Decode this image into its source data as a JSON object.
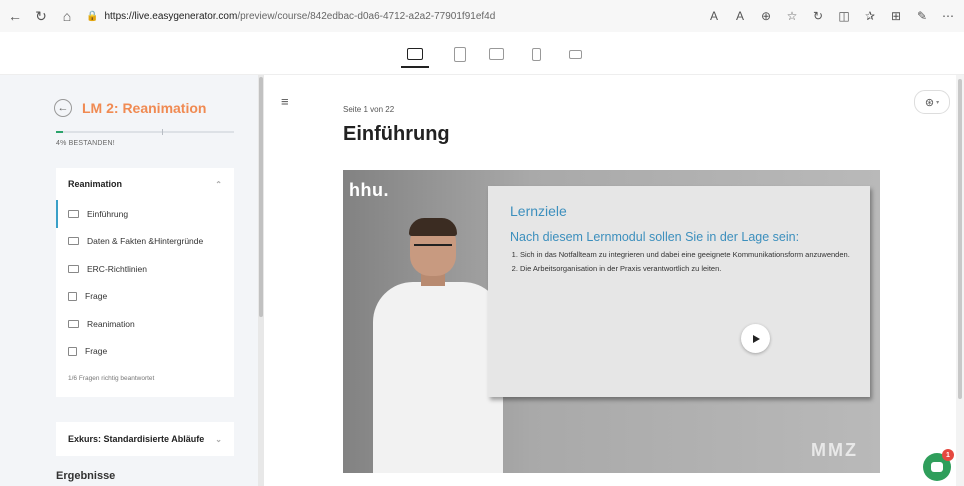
{
  "browser": {
    "url_host": "https://live.easygenerator.com",
    "url_path": "/preview/course/842edbac-d0a6-4712-a2a2-77901f91ef4d"
  },
  "course": {
    "title": "LM 2: Reanimation",
    "progress_percent": 4,
    "status_text": "4% BESTANDEN!"
  },
  "sidebar": {
    "sections": [
      {
        "title": "Reanimation",
        "lessons": [
          {
            "label": "Einführung",
            "active": true
          },
          {
            "label": "Daten & Fakten &Hintergründe"
          },
          {
            "label": "ERC-Richtlinien"
          },
          {
            "label": "Frage"
          },
          {
            "label": "Reanimation"
          },
          {
            "label": "Frage"
          }
        ],
        "question_stat": "1/6 Fragen richtig beantwortet"
      },
      {
        "title": "Exkurs: Standardisierte Abläufe"
      }
    ],
    "results_label": "Ergebnisse"
  },
  "main": {
    "page_counter": "Seite 1 von 22",
    "page_title": "Einführung"
  },
  "video": {
    "logo_left": "hhu.",
    "logo_right": "MMZ",
    "slide_title": "Lernziele",
    "slide_subtitle": "Nach diesem Lernmodul sollen Sie in der Lage sein:",
    "objectives": [
      "Sich in das Notfallteam zu integrieren und dabei eine geeignete Kommunikationsform anzuwenden.",
      "Die Arbeitsorganisation in der Praxis verantwortlich zu leiten."
    ]
  },
  "chat": {
    "badge_count": "1"
  }
}
